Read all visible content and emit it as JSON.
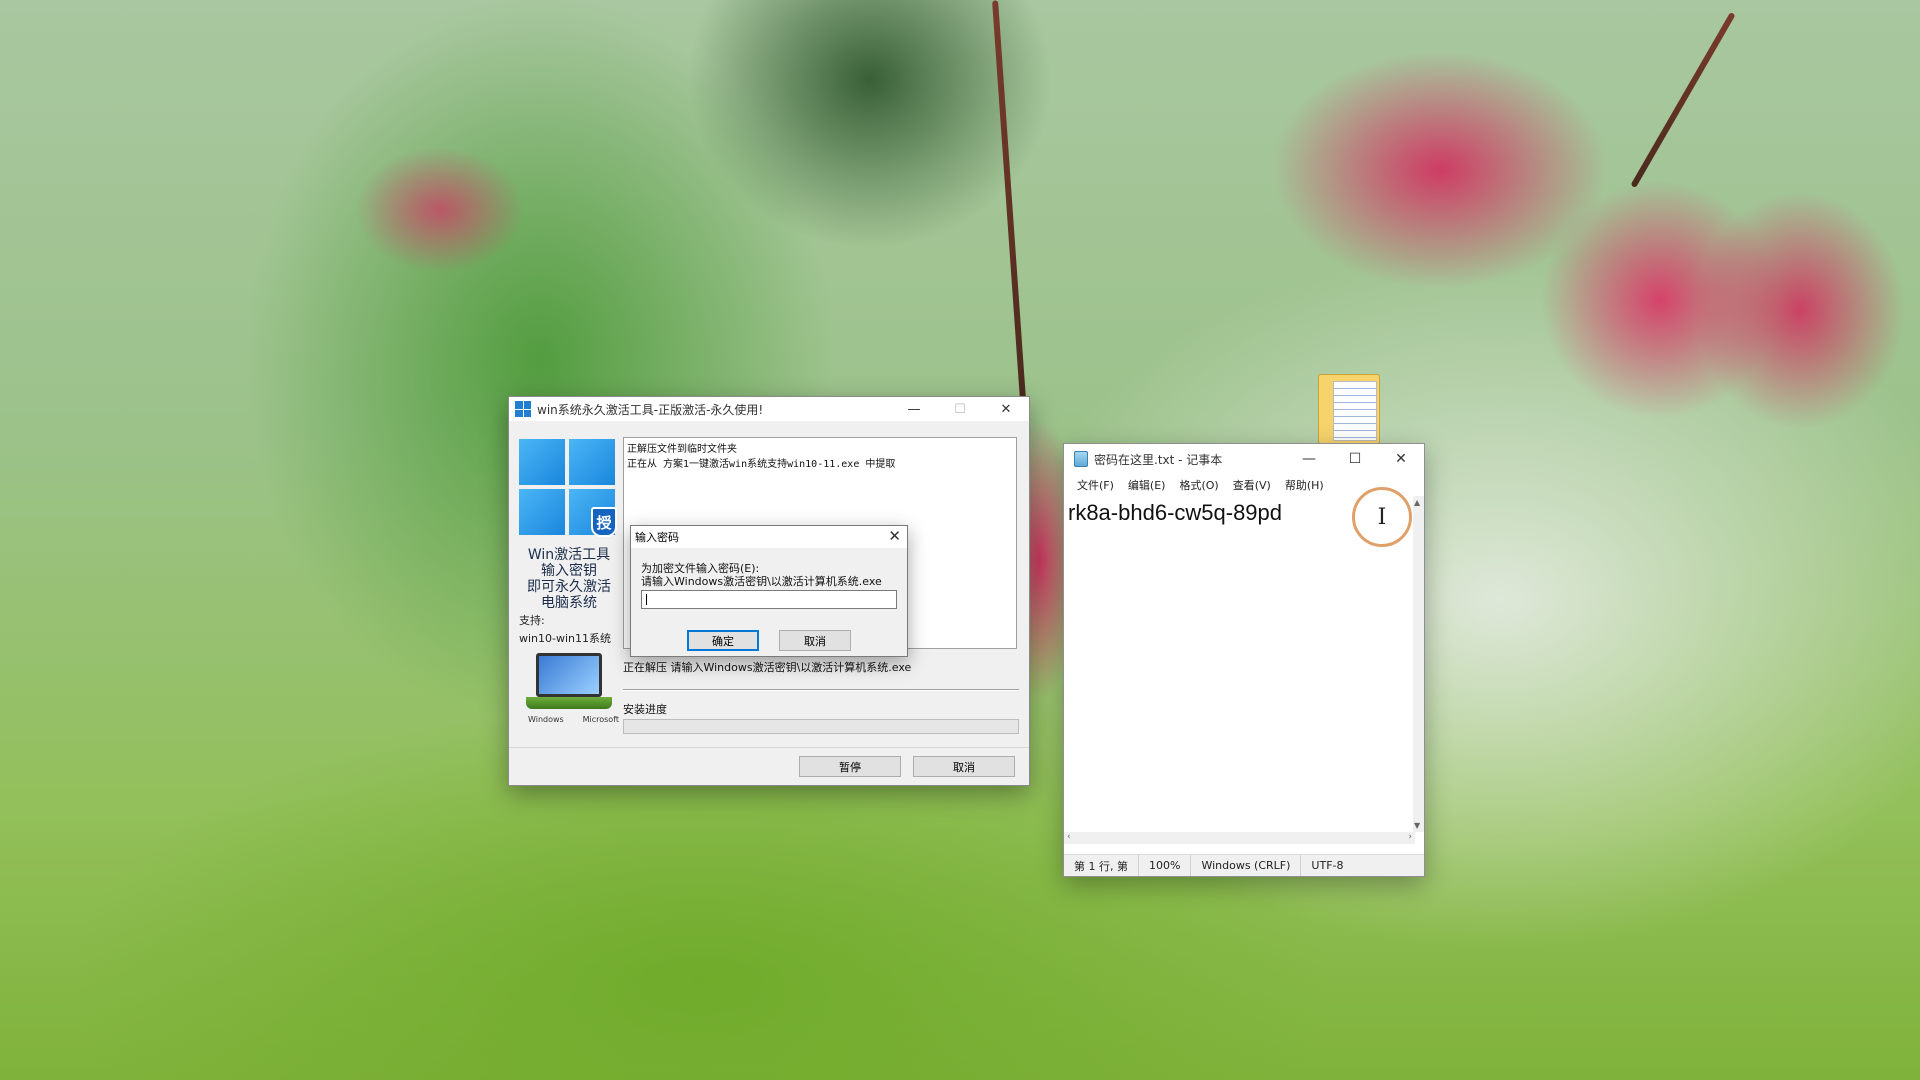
{
  "activator": {
    "title": "win系统永久激活工具-正版激活-永久使用!",
    "badge": "授",
    "promo": [
      "Win激活工具",
      "输入密钥",
      "即可永久激活",
      "电脑系统"
    ],
    "support_label": "支持:",
    "support_value": "win10-win11系统",
    "brand_windows": "Windows",
    "brand_microsoft": "Microsoft",
    "log_lines": [
      "正解压文件到临时文件夹",
      "正在从 方案1一键激活win系统支持win10-11.exe 中提取"
    ],
    "status_line": "正在解压 请输入Windows激活密钥\\以激活计算机系统.exe",
    "progress_label": "安装进度",
    "progress": 0,
    "pause_button": "暂停",
    "cancel_button": "取消"
  },
  "password_dialog": {
    "title": "输入密码",
    "prompt_line1": "为加密文件输入密码(E):",
    "prompt_line2": "请输入Windows激活密钥\\以激活计算机系统.exe",
    "password_value": "",
    "ok_button": "确定",
    "cancel_button": "取消"
  },
  "notepad": {
    "title": "密码在这里.txt - 记事本",
    "menu": [
      "文件(F)",
      "编辑(E)",
      "格式(O)",
      "查看(V)",
      "帮助(H)"
    ],
    "content": "rk8a-bhd6-cw5q-89pd",
    "status": {
      "position": "第 1 行, 第",
      "zoom": "100%",
      "line_ending": "Windows (CRLF)",
      "encoding": "UTF-8"
    }
  },
  "colors": {
    "win_blue": "#1f7fd1",
    "progress_green": "#06b025",
    "cursor_ring": "#e0a06a"
  }
}
